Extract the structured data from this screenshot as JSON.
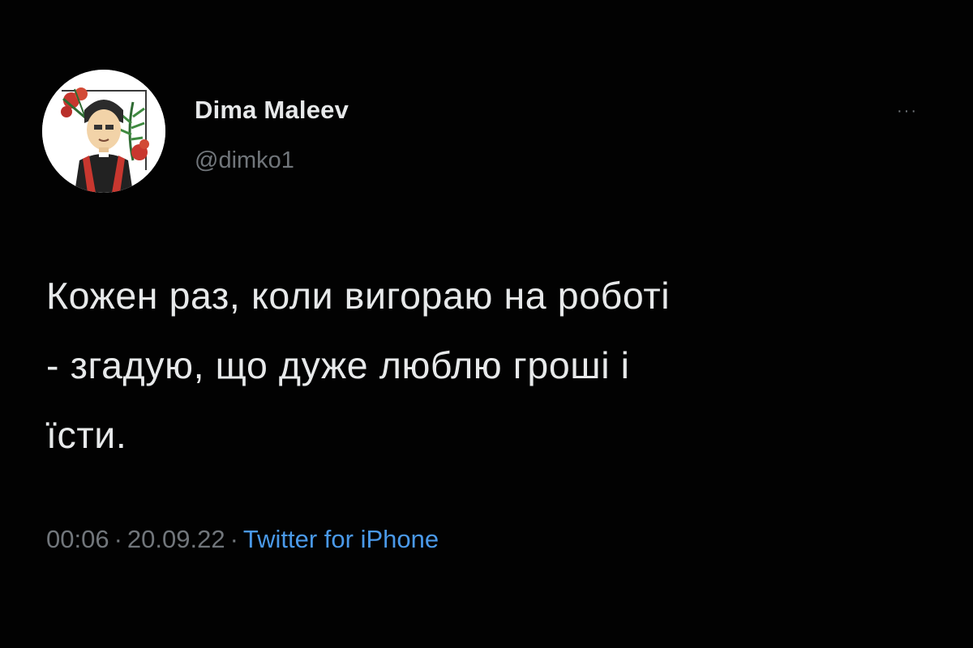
{
  "tweet": {
    "author": {
      "display_name": "Dima Maleev",
      "handle": "@dimko1",
      "avatar_icon": "user-avatar-illustration"
    },
    "more_icon": "more-options-icon",
    "text": "Кожен раз, коли вигораю на роботі\n- згадую, що дуже люблю гроші і\nїсти.",
    "time": "00:06",
    "separator": "·",
    "date": "20.09.22",
    "source": "Twitter for iPhone"
  },
  "colors": {
    "background": "#020202",
    "text_primary": "#e7e9ea",
    "text_secondary": "#71767b",
    "link": "#4a99e9"
  }
}
